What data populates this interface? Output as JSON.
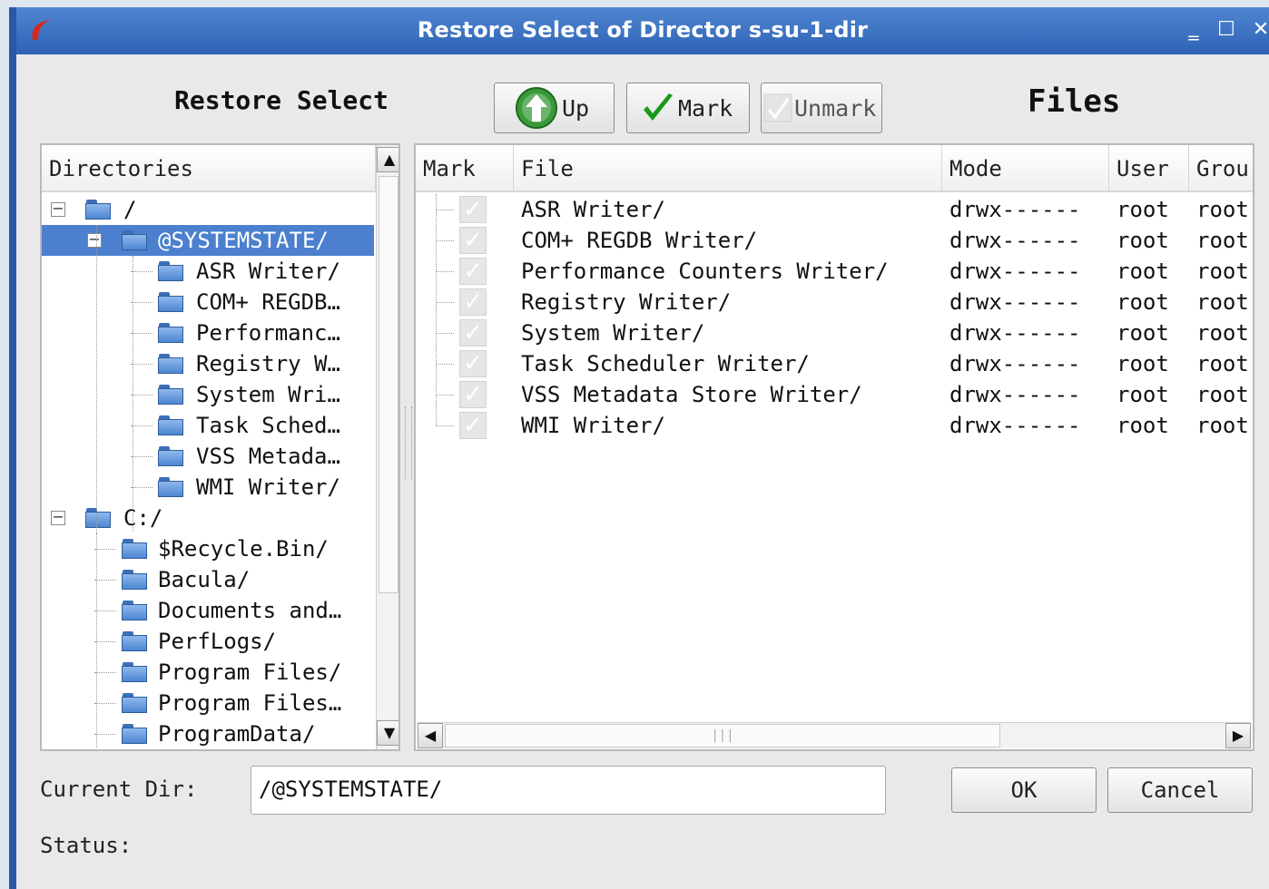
{
  "window": {
    "title": "Restore Select of Director s-su-1-dir"
  },
  "headings": {
    "restore_select": "Restore Select",
    "files": "Files"
  },
  "toolbar": {
    "up_label": "Up",
    "mark_label": "Mark",
    "unmark_label": "Unmark"
  },
  "directories": {
    "header": "Directories",
    "items": [
      {
        "label": "/",
        "depth": 0,
        "expander": "minus"
      },
      {
        "label": "@SYSTEMSTATE/",
        "depth": 1,
        "expander": "minus",
        "selected": true
      },
      {
        "label": "ASR Writer/",
        "depth": 2
      },
      {
        "label": "COM+ REGDB…",
        "depth": 2
      },
      {
        "label": "Performanc…",
        "depth": 2
      },
      {
        "label": "Registry W…",
        "depth": 2
      },
      {
        "label": "System Wri…",
        "depth": 2
      },
      {
        "label": "Task Sched…",
        "depth": 2
      },
      {
        "label": "VSS Metada…",
        "depth": 2
      },
      {
        "label": "WMI Writer/",
        "depth": 2
      },
      {
        "label": "C:/",
        "depth": 0,
        "expander": "minus"
      },
      {
        "label": "$Recycle.Bin/",
        "depth": 1
      },
      {
        "label": "Bacula/",
        "depth": 1
      },
      {
        "label": "Documents and…",
        "depth": 1
      },
      {
        "label": "PerfLogs/",
        "depth": 1
      },
      {
        "label": "Program Files/",
        "depth": 1
      },
      {
        "label": "Program Files…",
        "depth": 1
      },
      {
        "label": "ProgramData/",
        "depth": 1
      }
    ]
  },
  "files": {
    "columns": [
      "Mark",
      "File",
      "Mode",
      "User",
      "Grou"
    ],
    "rows": [
      {
        "file": "ASR Writer/",
        "mode": "drwx------",
        "user": "root",
        "group": "root",
        "marked": true
      },
      {
        "file": "COM+ REGDB Writer/",
        "mode": "drwx------",
        "user": "root",
        "group": "root",
        "marked": true
      },
      {
        "file": "Performance Counters Writer/",
        "mode": "drwx------",
        "user": "root",
        "group": "root",
        "marked": true
      },
      {
        "file": "Registry Writer/",
        "mode": "drwx------",
        "user": "root",
        "group": "root",
        "marked": true
      },
      {
        "file": "System Writer/",
        "mode": "drwx------",
        "user": "root",
        "group": "root",
        "marked": true
      },
      {
        "file": "Task Scheduler Writer/",
        "mode": "drwx------",
        "user": "root",
        "group": "root",
        "marked": true
      },
      {
        "file": "VSS Metadata Store Writer/",
        "mode": "drwx------",
        "user": "root",
        "group": "root",
        "marked": true
      },
      {
        "file": "WMI Writer/",
        "mode": "drwx------",
        "user": "root",
        "group": "root",
        "marked": true
      }
    ]
  },
  "footer": {
    "current_dir_label": "Current Dir:",
    "current_dir_value": "/@SYSTEMSTATE/",
    "ok_label": "OK",
    "cancel_label": "Cancel",
    "status_label": "Status:"
  },
  "colors": {
    "titlebar": "#2e62b5",
    "selection": "#4c80cf",
    "up_icon": "#3a9a3a",
    "check": "#1a9a1a"
  }
}
